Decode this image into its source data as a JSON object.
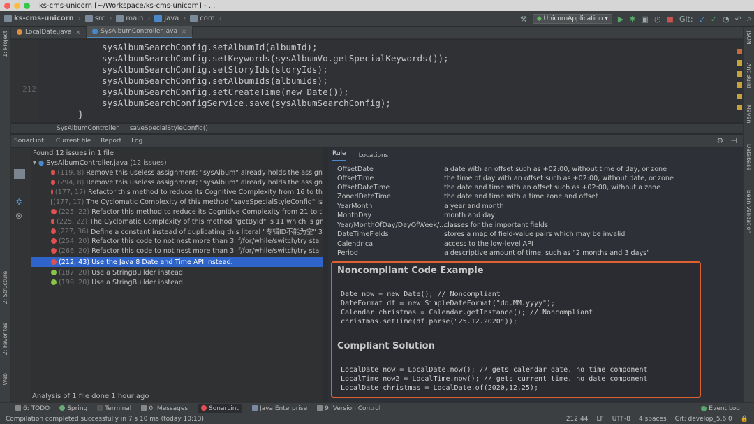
{
  "window": {
    "title": "ks-cms-unicorn [~/Workspace/ks-cms-unicorn] - ..."
  },
  "breadcrumb": [
    "ks-cms-unicorn",
    "src",
    "main",
    "java",
    "com"
  ],
  "toolbar": {
    "run_config": "UnicornApplication",
    "git_label": "Git:"
  },
  "tabs": [
    {
      "label": "LocalDate.java"
    },
    {
      "label": "SysAlbumController.java"
    }
  ],
  "side_tools_left": [
    "1: Project",
    "2: Structure",
    "2: Favorites",
    "Web"
  ],
  "side_tools_right": [
    "JSON",
    "Ant Build",
    "Maven",
    "Database",
    "Bean Validation"
  ],
  "editor": {
    "line_numbers": [
      "212"
    ],
    "lines": [
      {
        "text": "sysAlbumSearchConfig.setAlbumId(albumId);"
      },
      {
        "text": "sysAlbumSearchConfig.setKeywords(sysAlbumVo.getSpecialKeywords());"
      },
      {
        "text": "sysAlbumSearchConfig.setStoryIds(storyIds);"
      },
      {
        "text": "sysAlbumSearchConfig.setAlbumIds(albumIds);"
      },
      {
        "text": "sysAlbumSearchConfig.setCreateTime(new Date());"
      },
      {
        "text": "sysAlbumSearchConfigService.save(sysAlbumSearchConfig);"
      },
      {
        "text": "}"
      }
    ],
    "crumbs": [
      "SysAlbumController",
      "saveSpecialStyleConfig()"
    ]
  },
  "sonarlint": {
    "header": {
      "title": "SonarLint:",
      "tabs": [
        "Current file",
        "Report",
        "Log"
      ]
    },
    "found": "Found 12 issues in 1 file",
    "file": "SysAlbumController.java",
    "file_count": "(12 issues)",
    "issues": [
      {
        "coord": "(119, 8)",
        "text": "Remove this useless assignment; \"sysAlbum\" already holds the assign"
      },
      {
        "coord": "(294, 8)",
        "text": "Remove this useless assignment; \"sysAlbum\" already holds the assign"
      },
      {
        "coord": "(177, 17)",
        "text": "Refactor this method to reduce its Cognitive Complexity from 16 to th"
      },
      {
        "coord": "(177, 17)",
        "text": "The Cyclomatic Complexity of this method \"saveSpecialStyleConfig\" is"
      },
      {
        "coord": "(225, 22)",
        "text": "Refactor this method to reduce its Cognitive Complexity from 21 to t"
      },
      {
        "coord": "(225, 22)",
        "text": "The Cyclomatic Complexity of this method \"getById\" is 11 which is gr"
      },
      {
        "coord": "(227, 36)",
        "text": "Define a constant instead of duplicating this literal \"专辑ID不能为空\" 3"
      },
      {
        "coord": "(254, 20)",
        "text": "Refactor this code to not nest more than 3 if/for/while/switch/try sta"
      },
      {
        "coord": "(266, 20)",
        "text": "Refactor this code to not nest more than 3 if/for/while/switch/try sta"
      },
      {
        "coord": "(212, 43)",
        "text": "Use the Java 8 Date and Time API instead."
      },
      {
        "coord": "(187, 20)",
        "text": "Use a StringBuilder instead."
      },
      {
        "coord": "(199, 20)",
        "text": "Use a StringBuilder instead."
      }
    ],
    "analysis": "Analysis of 1 file done 1 hour ago"
  },
  "rule_panel": {
    "tabs": [
      "Rule",
      "Locations"
    ],
    "table": [
      {
        "name": "OffsetDate",
        "desc": "a date with an offset such as +02:00, without time of day, or zone"
      },
      {
        "name": "OffsetTime",
        "desc": "the time of day with an offset such as +02:00, without date, or zone"
      },
      {
        "name": "OffsetDateTime",
        "desc": "the date and time with an offset such as +02:00, without a zone"
      },
      {
        "name": "ZonedDateTime",
        "desc": "the date and time with a time zone and offset"
      },
      {
        "name": "YearMonth",
        "desc": "a year and month"
      },
      {
        "name": "MonthDay",
        "desc": "month and day"
      },
      {
        "name": "Year/MonthOfDay/DayOfWeek/...",
        "desc": "classes for the important fields"
      },
      {
        "name": "DateTimeFields",
        "desc": "stores a map of field-value pairs which may be invalid"
      },
      {
        "name": "Calendrical",
        "desc": "access to the low-level API"
      },
      {
        "name": "Period",
        "desc": "a descriptive amount of time, such as \"2 months and 3 days\""
      }
    ],
    "noncompliant_title": "Noncompliant Code Example",
    "noncompliant_code": [
      "Date now = new Date(); // Noncompliant",
      "DateFormat df = new SimpleDateFormat(\"dd.MM.yyyy\");",
      "Calendar christmas = Calendar.getInstance(); // Noncompliant",
      "christmas.setTime(df.parse(\"25.12.2020\"));"
    ],
    "compliant_title": "Compliant Solution",
    "compliant_code": [
      "LocalDate now = LocalDate.now(); // gets calendar date. no time component",
      "LocalTime now2 = LocalTime.now(); // gets current time. no date component",
      "LocalDate christmas = LocalDate.of(2020,12,25);"
    ]
  },
  "bottom_tools": [
    "6: TODO",
    "Spring",
    "Terminal",
    "0: Messages",
    "SonarLint",
    "Java Enterprise",
    "9: Version Control"
  ],
  "event_log": "Event Log",
  "status": {
    "message": "Compilation completed successfully in 7 s 10 ms (today 10:13)",
    "position": "212:44",
    "line_sep": "LF",
    "encoding": "UTF-8",
    "indent": "4 spaces",
    "branch": "Git: develop_5.6.0"
  },
  "colors": {
    "accent": "#2f65ca",
    "highlight_border": "#e06030",
    "severity_major": "#e05050",
    "severity_minor": "#8bc34a"
  }
}
